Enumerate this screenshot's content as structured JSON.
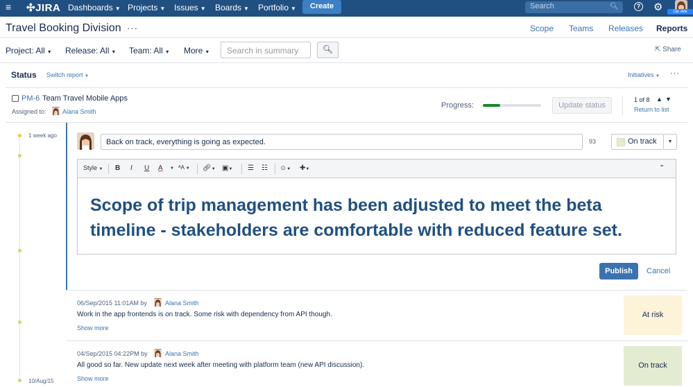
{
  "nav": {
    "logo": "JIRA",
    "items": [
      "Dashboards",
      "Projects",
      "Issues",
      "Boards",
      "Portfolio"
    ],
    "create": "Create",
    "search_placeholder": "Search",
    "clip_badge": "Clip slide"
  },
  "header": {
    "title": "Travel Booking Division",
    "more": "···",
    "tabs": [
      "Scope",
      "Teams",
      "Releases",
      "Reports"
    ],
    "active_tab": "Reports"
  },
  "filters": {
    "project": "Project: All",
    "release": "Release: All",
    "team": "Team: All",
    "more": "More",
    "search_placeholder": "Search in summary",
    "share": "Share"
  },
  "status_bar": {
    "title": "Status",
    "switch_report": "Switch report",
    "initiatives": "Initiatives",
    "more": "···"
  },
  "issue": {
    "key": "PM-6",
    "title": "Team Travel Mobile Apps",
    "assigned_label": "Assigned to:",
    "assignee": "Alana Smith",
    "progress_label": "Progress:",
    "progress_fraction": 0.3,
    "update_status": "Update status",
    "pager": "1 of 8",
    "return_link": "Return to list"
  },
  "timeline": {
    "top_date": "1 week ago",
    "bottom_date": "10/Aug/15"
  },
  "editor": {
    "comment_value": "Back on track, everything is going as expected.",
    "char_count": "93",
    "status_value": "On track",
    "toolbar": {
      "style": "Style",
      "bold": "B",
      "italic": "I",
      "underline": "U",
      "color": "A",
      "text_size": "A"
    },
    "body": "Scope of trip management has been adjusted to meet the beta timeline - stakeholders are comfortable with reduced feature set.",
    "publish": "Publish",
    "cancel": "Cancel"
  },
  "history": [
    {
      "meta": "06/Sep/2015 11:01AM by",
      "author": "Alana Smith",
      "text": "Work in the app frontends is on track. Some risk with dependency from API though.",
      "more": "Show more",
      "status": "At risk",
      "color": "#fcf3d9"
    },
    {
      "meta": "04/Sep/2015 04:22PM by",
      "author": "Alana Smith",
      "text": "All good so far. New update next week after meeting with platform team (new API discussion).",
      "more": "Show more",
      "status": "On track",
      "color": "#e3ecd1"
    }
  ]
}
